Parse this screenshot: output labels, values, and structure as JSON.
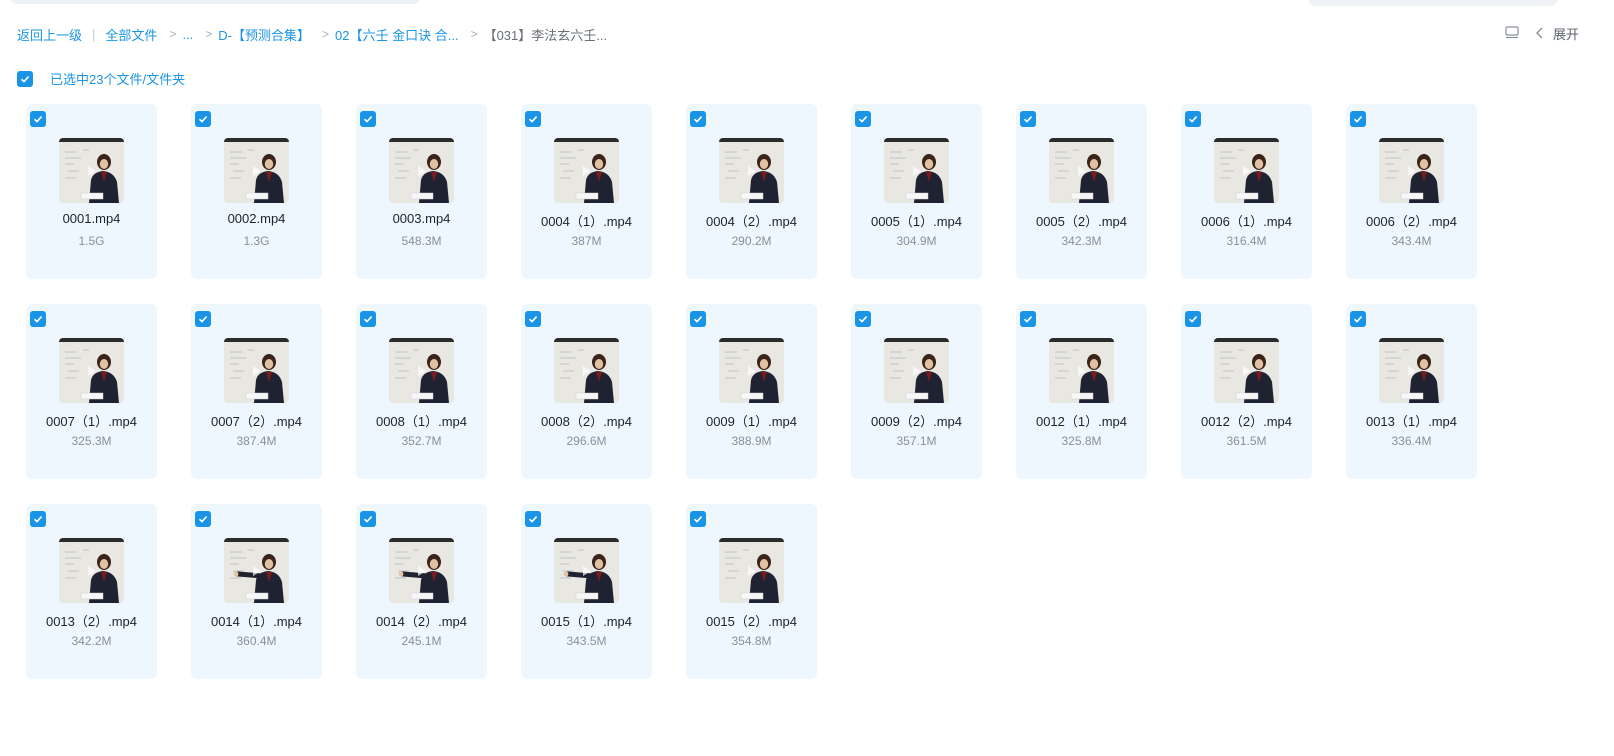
{
  "breadcrumb": {
    "back": "返回上一级",
    "all_files": "全部文件",
    "ellipsis": "...",
    "sep": ">",
    "crumb1": "D-【预测合集】",
    "crumb2": "02【六壬 金口诀 合...",
    "current": "【031】李法玄六壬..."
  },
  "toolbar": {
    "list_view_icon": "list-view-icon",
    "expand_label": "展开"
  },
  "selection": {
    "label": "已选中23个文件/文件夹",
    "checked": true
  },
  "colors": {
    "accent": "#1a94e6",
    "tile_bg": "#eef7fd"
  },
  "files": [
    {
      "name": "0001.mp4",
      "size": "1.5G",
      "pose": "seated"
    },
    {
      "name": "0002.mp4",
      "size": "1.3G",
      "pose": "seated"
    },
    {
      "name": "0003.mp4",
      "size": "548.3M",
      "pose": "seated"
    },
    {
      "name": "0004（1）.mp4",
      "size": "387M",
      "pose": "seated"
    },
    {
      "name": "0004（2）.mp4",
      "size": "290.2M",
      "pose": "seated"
    },
    {
      "name": "0005（1）.mp4",
      "size": "304.9M",
      "pose": "seated"
    },
    {
      "name": "0005（2）.mp4",
      "size": "342.3M",
      "pose": "seated"
    },
    {
      "name": "0006（1）.mp4",
      "size": "316.4M",
      "pose": "seated"
    },
    {
      "name": "0006（2）.mp4",
      "size": "343.4M",
      "pose": "seated"
    },
    {
      "name": "0007（1）.mp4",
      "size": "325.3M",
      "pose": "seated"
    },
    {
      "name": "0007（2）.mp4",
      "size": "387.4M",
      "pose": "seated"
    },
    {
      "name": "0008（1）.mp4",
      "size": "352.7M",
      "pose": "seated"
    },
    {
      "name": "0008（2）.mp4",
      "size": "296.6M",
      "pose": "seated"
    },
    {
      "name": "0009（1）.mp4",
      "size": "388.9M",
      "pose": "seated"
    },
    {
      "name": "0009（2）.mp4",
      "size": "357.1M",
      "pose": "seated"
    },
    {
      "name": "0012（1）.mp4",
      "size": "325.8M",
      "pose": "seated"
    },
    {
      "name": "0012（2）.mp4",
      "size": "361.5M",
      "pose": "seated"
    },
    {
      "name": "0013（1）.mp4",
      "size": "336.4M",
      "pose": "seated"
    },
    {
      "name": "0013（2）.mp4",
      "size": "342.2M",
      "pose": "seated"
    },
    {
      "name": "0014（1）.mp4",
      "size": "360.4M",
      "pose": "pointing"
    },
    {
      "name": "0014（2）.mp4",
      "size": "245.1M",
      "pose": "pointing"
    },
    {
      "name": "0015（1）.mp4",
      "size": "343.5M",
      "pose": "pointing"
    },
    {
      "name": "0015（2）.mp4",
      "size": "354.8M",
      "pose": "seated"
    }
  ]
}
